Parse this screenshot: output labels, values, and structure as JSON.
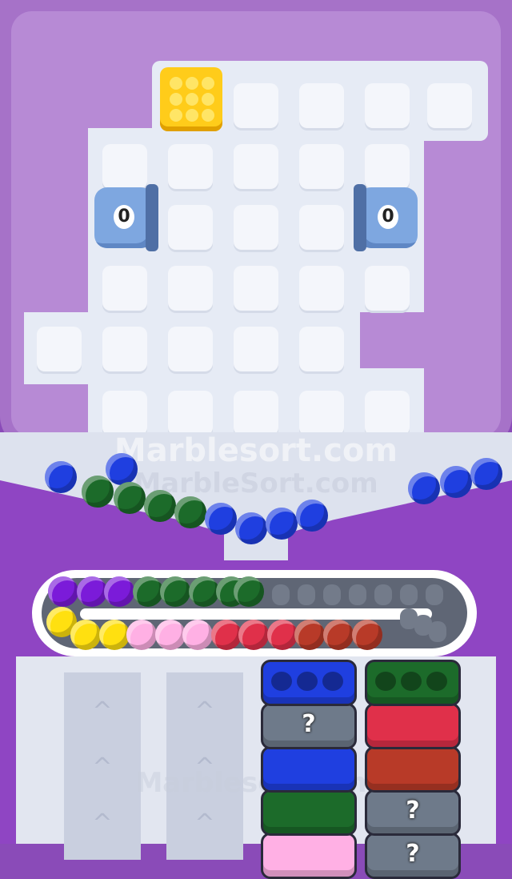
{
  "colors": {
    "blue": "#1f3fe0",
    "green": "#1c6b2a",
    "purple": "#7b1bd9",
    "yellow": "#ffe010",
    "pink": "#ffb0e4",
    "red": "#e0304a",
    "brown": "#b83a28",
    "gray": "#6e7a8a",
    "frame": "#a672c8"
  },
  "cannons": [
    {
      "side": "left",
      "count": "0"
    },
    {
      "side": "right",
      "count": "0"
    }
  ],
  "watermark": {
    "primary": "Marblesort.com",
    "secondary": "MarbleSort.com",
    "faint": "Marblesort.com"
  },
  "funnel_marbles": [
    "blue",
    "blue",
    "green",
    "green",
    "green",
    "green",
    "blue",
    "blue",
    "blue",
    "blue",
    "blue",
    "blue",
    "blue"
  ],
  "conveyor_top": [
    "purple",
    "purple",
    "purple",
    "green",
    "green",
    "green",
    "green",
    "green"
  ],
  "conveyor_bottom": [
    "yellow",
    "yellow",
    "yellow",
    "pink",
    "pink",
    "pink",
    "red",
    "red",
    "red",
    "brown",
    "brown",
    "brown"
  ],
  "empty_slots": 10,
  "stacks": {
    "left": [
      {
        "color": "blue",
        "type": "open"
      },
      {
        "color": "gray",
        "type": "hidden",
        "label": "?"
      },
      {
        "color": "blue",
        "type": "closed"
      },
      {
        "color": "green",
        "type": "closed"
      },
      {
        "color": "pink",
        "type": "closed"
      }
    ],
    "right": [
      {
        "color": "green",
        "type": "open"
      },
      {
        "color": "red",
        "type": "closed"
      },
      {
        "color": "brown",
        "type": "closed"
      },
      {
        "color": "gray",
        "type": "hidden",
        "label": "?"
      },
      {
        "color": "gray",
        "type": "hidden",
        "label": "?"
      }
    ]
  }
}
